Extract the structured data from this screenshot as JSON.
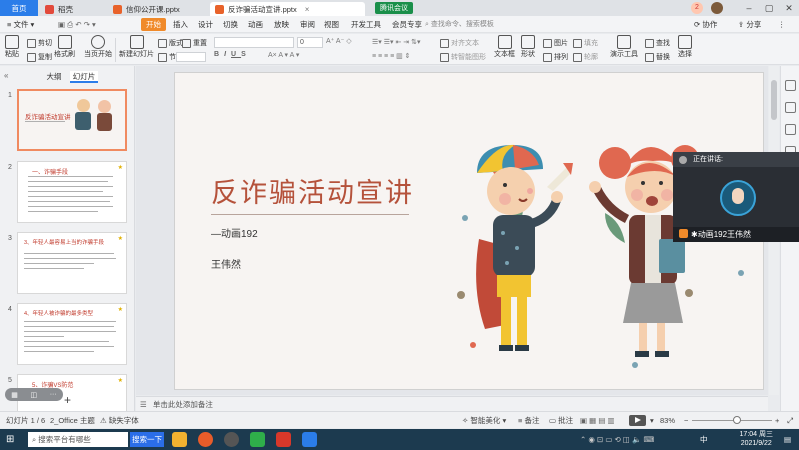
{
  "tabs": {
    "home": "首页",
    "docer": "稻壳",
    "file1": "信仰公开课.pptx",
    "file2": "反诈骗活动宣讲.pptx",
    "meeting": "腾讯会议",
    "login_badge": "2"
  },
  "menu": {
    "file": "文件",
    "items": [
      "开始",
      "插入",
      "设计",
      "切换",
      "动画",
      "放映",
      "审阅",
      "视图",
      "开发工具",
      "会员专享"
    ],
    "search": "查找命令、搜索模板",
    "collab": "协作",
    "share": "分享"
  },
  "ribbon": {
    "paste": "粘贴",
    "cut": "剪切",
    "copy": "复制",
    "format_painter": "格式刷",
    "play_from_current": "当页开始",
    "new_slide": "新建幻灯片",
    "layout": "版式",
    "section": "节",
    "reset": "重置",
    "font_size_value": "0",
    "align_objects": "对齐文本",
    "convert_to_smartart": "转智能图形",
    "textbox": "文本框",
    "shape": "形状",
    "picture": "图片",
    "fill": "填充",
    "arrange": "排列",
    "outline": "轮廓",
    "presentation_tools": "演示工具",
    "find": "查找",
    "replace": "替换",
    "select": "选择"
  },
  "left_panel": {
    "tab_outline": "大纲",
    "tab_slides": "幻灯片",
    "slides": [
      {
        "num": "1",
        "title": "反诈骗活动宣讲"
      },
      {
        "num": "2",
        "title": "一、诈骗手段"
      },
      {
        "num": "3",
        "title": "3、年轻人最容易上当的诈骗手段"
      },
      {
        "num": "4",
        "title": "4、年轻人被诈骗的最多类型"
      },
      {
        "num": "5",
        "title": "5、诈骗VS防范"
      }
    ]
  },
  "slide": {
    "title": "反诈骗活动宣讲",
    "subtitle": "—动画192",
    "author": "王伟然"
  },
  "notes": {
    "placeholder": "单击此处添加备注"
  },
  "meeting": {
    "speaking_label": "正在讲话:",
    "participant": "动画192王伟然"
  },
  "status": {
    "slide_info": "幻灯片 1 / 6",
    "theme": "2_Office 主题",
    "missing_font": "缺失字体",
    "smart_beautify": "智能美化",
    "notes": "备注",
    "comments": "批注",
    "zoom": "83%"
  },
  "taskbar": {
    "search_hint": "搜索平台有哪些",
    "baidu": "搜索一下",
    "time": "17:04 周三",
    "date": "2021/9/22",
    "lang": "中"
  },
  "colors": {
    "accent": "#f08a2a",
    "title_red": "#b5523b",
    "taskbar": "#1c3a4f"
  }
}
